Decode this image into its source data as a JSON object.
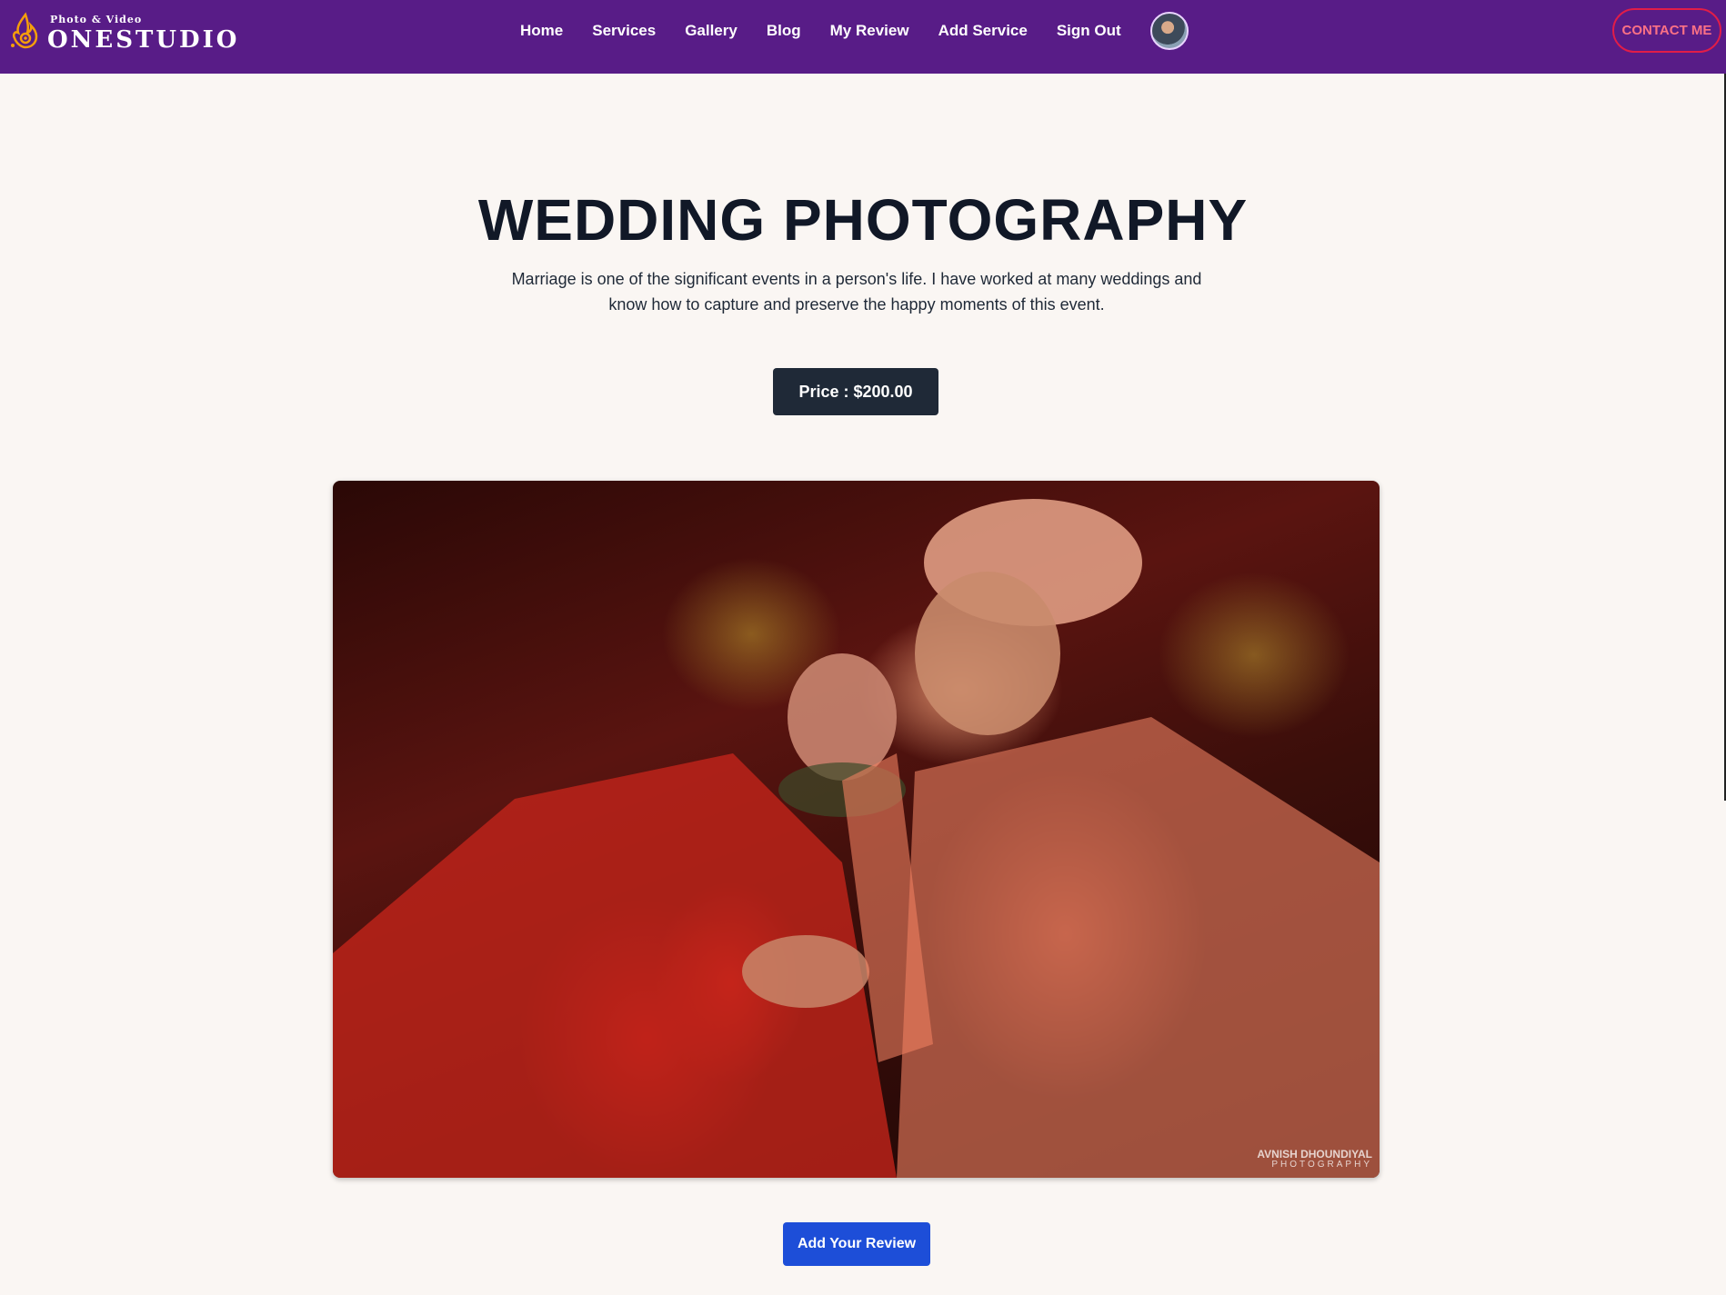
{
  "brand": {
    "tagline": "Photo & Video",
    "name": "ONESTUDIO"
  },
  "nav": {
    "items": [
      "Home",
      "Services",
      "Gallery",
      "Blog",
      "My Review",
      "Add Service",
      "Sign Out"
    ],
    "contact_label": "CONTACT ME"
  },
  "service": {
    "title": "WEDDING PHOTOGRAPHY",
    "description": "Marriage is one of the significant events in a person's life. I have worked at many weddings and know how to capture and preserve the happy moments of this event.",
    "price_label": "Price : $200.00",
    "image_watermark": {
      "line1": "AVNISH DHOUNDIYAL",
      "line2": "PHOTOGRAPHY"
    }
  },
  "actions": {
    "add_review_label": "Add Your Review"
  },
  "colors": {
    "navbar": "#581c87",
    "contact_border": "#e11d48",
    "price_button": "#1f2937",
    "review_button": "#1d4ed8",
    "page_background": "#faf6f3"
  }
}
